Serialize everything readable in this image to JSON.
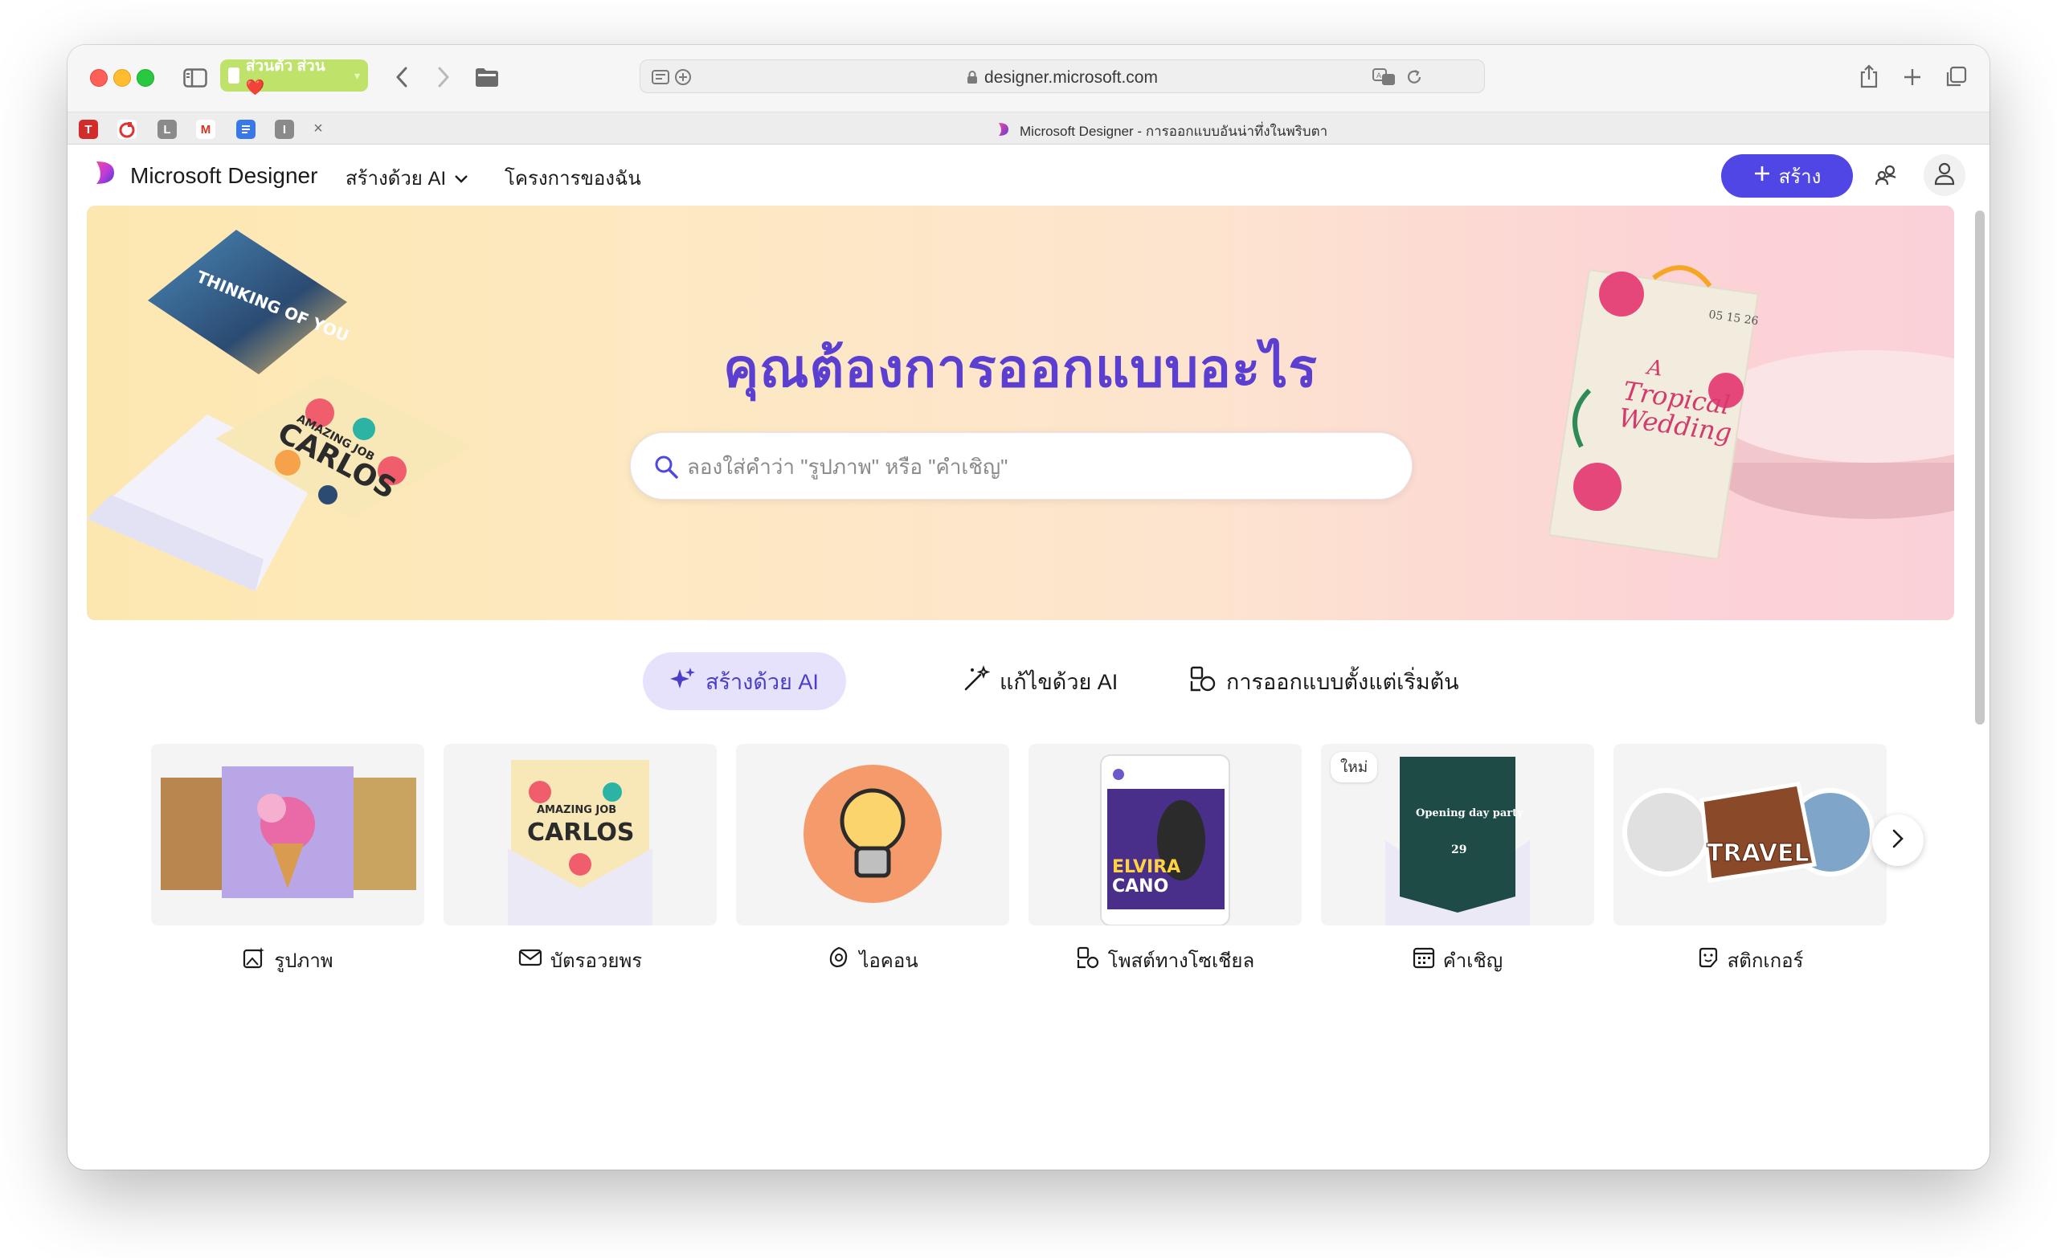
{
  "browser": {
    "profile_label": "ส่วนตัว ส่วน ❤️",
    "url": "designer.microsoft.com",
    "tab_title": "Microsoft Designer - การออกแบบอันน่าทึ่งในพริบตา",
    "pinned_tabs": [
      "T",
      "L",
      "M",
      "I"
    ]
  },
  "header": {
    "brand": "Microsoft Designer",
    "nav_create_ai": "สร้างด้วย AI",
    "nav_projects": "โครงการของฉัน",
    "create_button": "สร้าง"
  },
  "hero": {
    "title": "คุณต้องการออกแบบอะไร",
    "search_placeholder": "ลองใส่คำว่า \"รูปภาพ\" หรือ \"คำเชิญ\"",
    "card_left_top_text": "THINKING OF YOU",
    "card_left_bottom_small": "AMAZING JOB",
    "card_left_bottom_name": "CARLOS",
    "invite_date": "05 15 26",
    "invite_title_1": "A",
    "invite_title_2": "Tropical",
    "invite_title_3": "Wedding"
  },
  "modes": [
    {
      "label": "สร้างด้วย AI",
      "icon": "sparkle-icon",
      "active": true
    },
    {
      "label": "แก้ไขด้วย AI",
      "icon": "magic-wand-icon",
      "active": false
    },
    {
      "label": "การออกแบบตั้งแต่เริ่มต้น",
      "icon": "shapes-icon",
      "active": false
    }
  ],
  "categories": [
    {
      "label": "รูปภาพ",
      "icon": "image-sparkle-icon"
    },
    {
      "label": "บัตรอวยพร",
      "icon": "envelope-icon",
      "preview_small": "AMAZING JOB",
      "preview_name": "CARLOS"
    },
    {
      "label": "ไอคอน",
      "icon": "icon-shape-icon"
    },
    {
      "label": "โพสต์ทางโซเชียล",
      "icon": "social-post-icon",
      "preview_name_1": "ELVIRA",
      "preview_name_2": "CANO"
    },
    {
      "label": "คำเชิญ",
      "icon": "calendar-icon",
      "badge": "ใหม่",
      "preview_title": "Opening day party",
      "preview_date": "29"
    },
    {
      "label": "สติกเกอร์",
      "icon": "sticker-icon",
      "preview_word": "TRAVEL"
    }
  ],
  "colors": {
    "accent": "#4f46e5",
    "hero_title": "#5a3fd0",
    "active_tab_bg": "#e6e2fb"
  }
}
